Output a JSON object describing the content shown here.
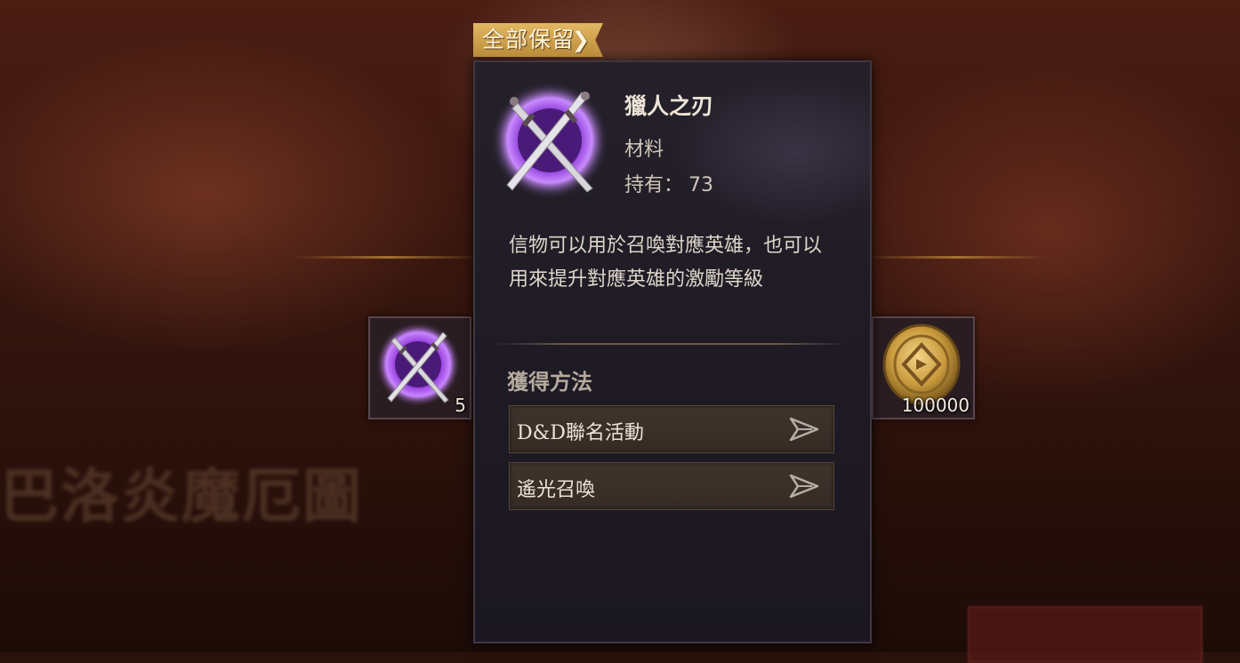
{
  "background": {
    "event_title": "巴洛炎魔厄圖"
  },
  "tag": {
    "label": "全部保留",
    "chevron": "❯"
  },
  "rewards": [
    {
      "icon": "crossed-blades-icon",
      "count": "5"
    },
    {
      "icon": "gold-coin-icon",
      "count": "100000"
    }
  ],
  "item": {
    "name": "獵人之刃",
    "type": "材料",
    "owned_label": "持有：",
    "owned_count": "73",
    "description": "信物可以用於召喚對應英雄，也可以用來提升對應英雄的激勵等級"
  },
  "sources": {
    "header": "獲得方法",
    "items": [
      {
        "label": "D&D聯名活動",
        "icon": "arrow-right-icon"
      },
      {
        "label": "遙光召喚",
        "icon": "arrow-right-icon"
      }
    ]
  },
  "colors": {
    "panel": "#201c25",
    "tag_gold": "#d6a752",
    "icon_purple": "#b060f0",
    "coin_gold": "#c99a3c"
  }
}
